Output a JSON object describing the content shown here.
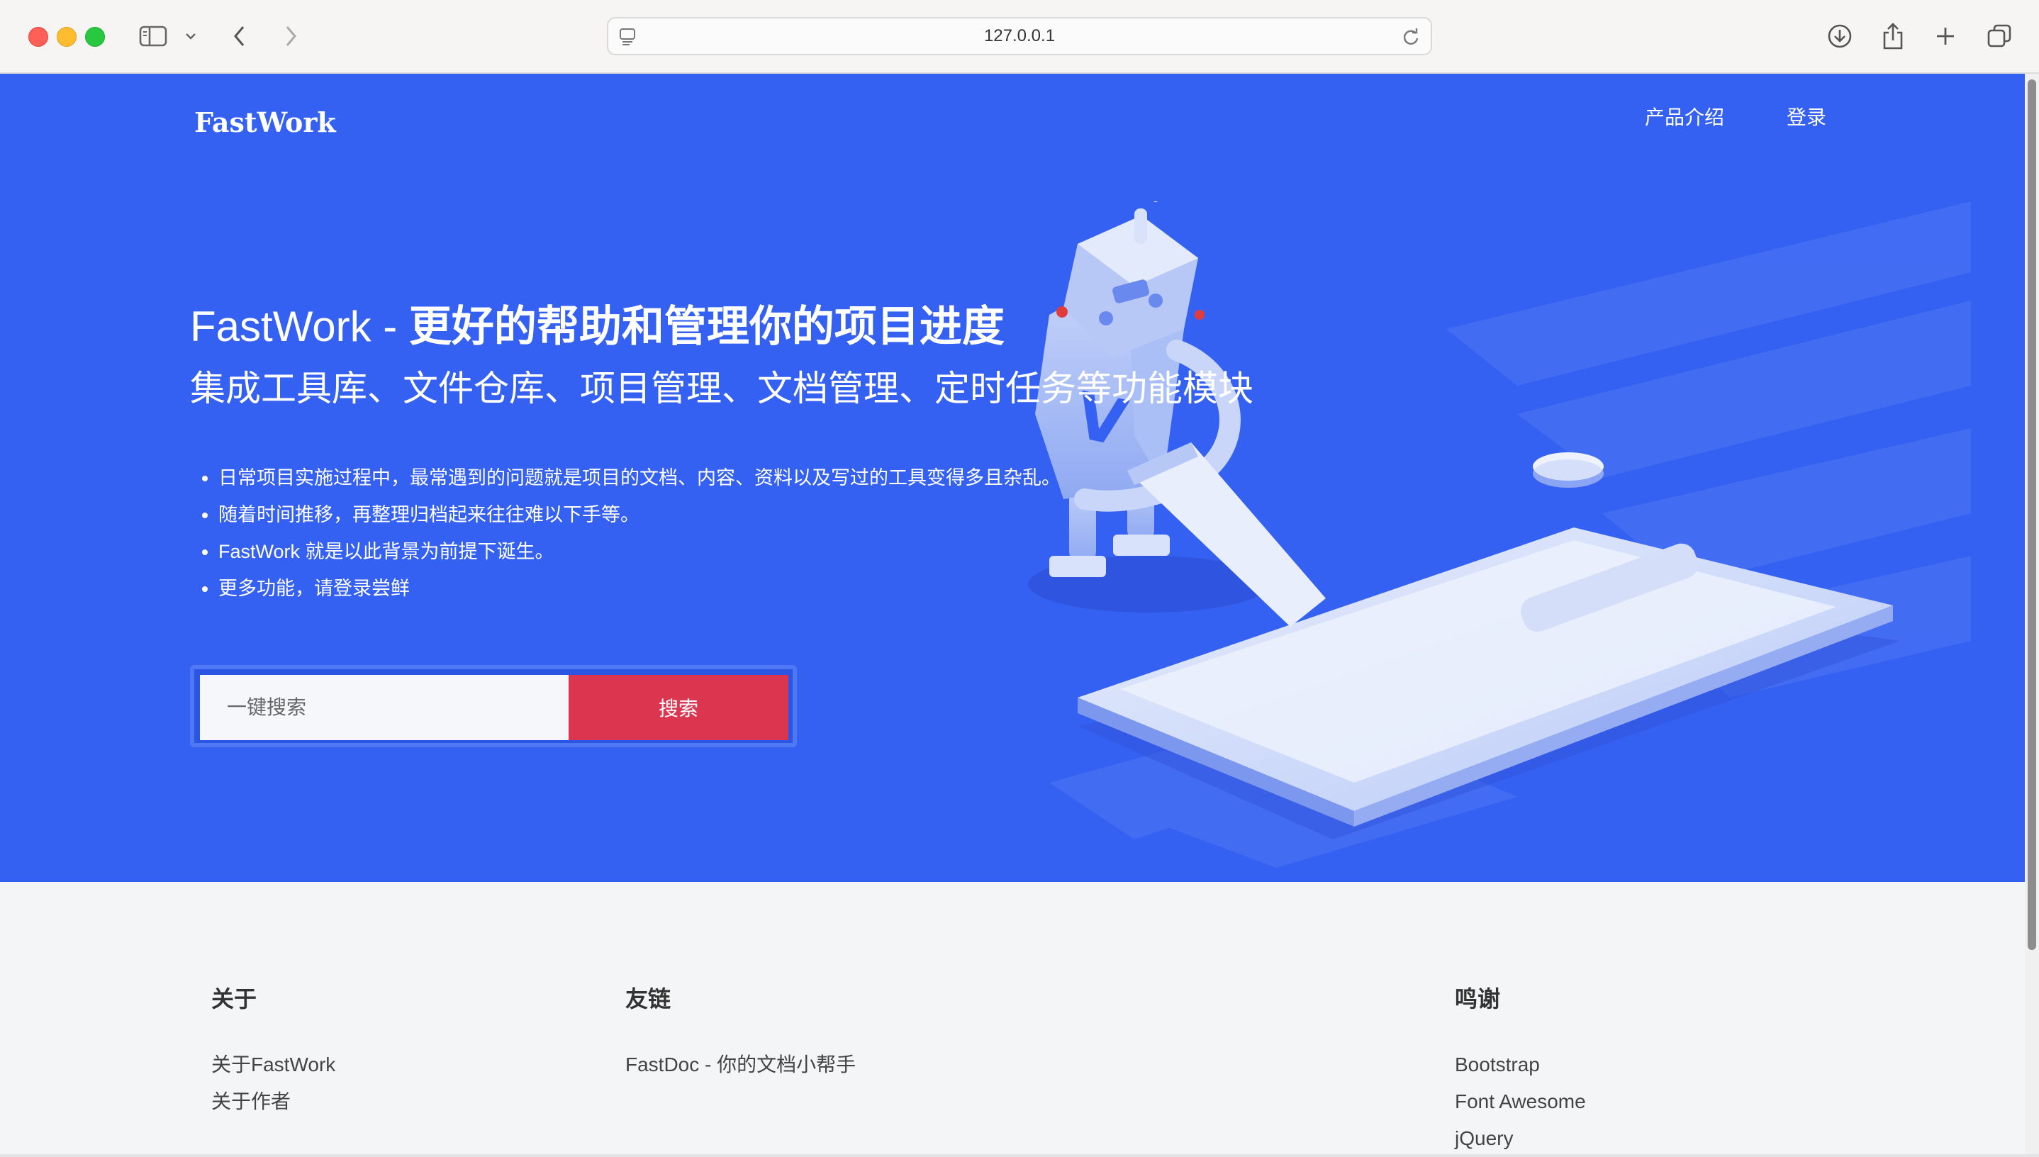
{
  "browser": {
    "url": "127.0.0.1"
  },
  "nav": {
    "brand": "FastWork",
    "links": [
      "产品介绍",
      "登录"
    ]
  },
  "hero": {
    "title_latin": "FastWork - ",
    "title_cjk": "更好的帮助和管理你的项目进度",
    "subtitle": "集成工具库、文件仓库、项目管理、文档管理、定时任务等功能模块",
    "bullets": [
      "日常项目实施过程中，最常遇到的问题就是项目的文档、内容、资料以及写过的工具变得多且杂乱。",
      "随着时间推移，再整理归档起来往往难以下手等。",
      "FastWork 就是以此背景为前提下诞生。",
      "更多功能，请登录尝鲜"
    ],
    "search": {
      "placeholder": "一键搜索",
      "button_label": "搜索"
    }
  },
  "footer": {
    "about": {
      "heading": "关于",
      "links": [
        "关于FastWork",
        "关于作者"
      ]
    },
    "friends": {
      "heading": "友链",
      "links": [
        "FastDoc - 你的文档小帮手"
      ]
    },
    "thanks": {
      "heading": "鸣谢",
      "links": [
        "Bootstrap",
        "Font Awesome",
        "jQuery"
      ]
    }
  },
  "icons": {
    "sidebar": "sidebar-icon",
    "back": "chevron-left-icon",
    "forward": "chevron-right-icon",
    "reload": "reload-icon",
    "download": "download-icon",
    "share": "share-icon",
    "new_tab": "plus-icon",
    "tabs": "tabs-icon"
  },
  "colors": {
    "hero_bg": "#3561f2",
    "search_button": "#dc3550",
    "footer_bg": "#f4f5f7"
  }
}
